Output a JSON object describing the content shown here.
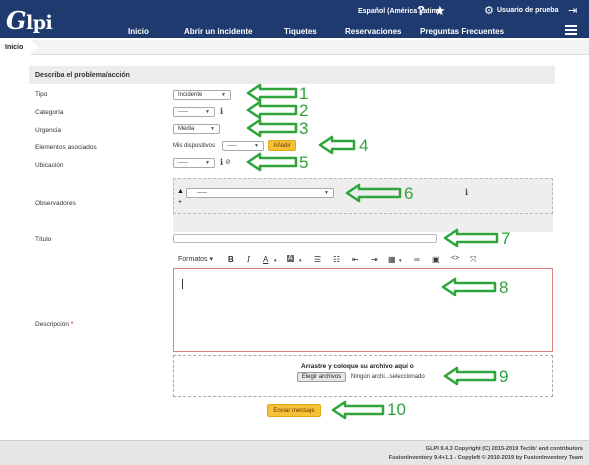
{
  "app": {
    "logo_text": "lpi",
    "logo_initial": "G"
  },
  "utility": {
    "language": "Español (América Latina)",
    "help_glyph": "?",
    "star_glyph": "★",
    "gear_glyph": "⚙",
    "user": "Usuario de prueba",
    "logout_glyph": "⇥"
  },
  "menu": {
    "items": [
      "Inicio",
      "Abrir un incidente",
      "Tiquetes",
      "Reservaciones",
      "Preguntas Frecuentes"
    ]
  },
  "breadcrumb": "Inicio",
  "form": {
    "header": "Describa el problema/acción",
    "tipo": {
      "label": "Tipo",
      "value": "Incidente"
    },
    "categoria": {
      "label": "Categoría",
      "value": "-----"
    },
    "urgencia": {
      "label": "Urgencia",
      "value": "Media"
    },
    "elementos": {
      "label": "Elementos asociados",
      "mis": "Mis dispositivos",
      "value": "-----",
      "add_button": "Añadir"
    },
    "ubicacion": {
      "label": "Ubicación",
      "value": "-----"
    },
    "observadores": {
      "label": "Observadores",
      "value": "-----"
    },
    "titulo": {
      "label": "Título",
      "value": ""
    },
    "descripcion": {
      "label": "Descripción",
      "required_mark": "*"
    },
    "toolbar": {
      "formats": "Formatos"
    },
    "dropzone": {
      "text": "Arrastre y coloque su archivo aquí o",
      "choose": "Elegir archivos",
      "none": "Ningún archi...seleccionado"
    },
    "submit": "Enviar mensaje"
  },
  "annotations": [
    "1",
    "2",
    "3",
    "4",
    "5",
    "6",
    "7",
    "8",
    "9",
    "10"
  ],
  "footer": {
    "line1": "GLPI 9.4.3 Copyright (C) 2015-2019 Teclib' and contributors",
    "line2": "FusionInventory 9.4+1.1 - Copyleft © 2010-2019 by FusionInventory Team"
  },
  "colors": {
    "header": "#1f3a6e",
    "accent_button": "#f6c037",
    "annotation": "#2ea43a",
    "required": "#cc0000"
  },
  "icons": [
    "help-icon",
    "star-icon",
    "gear-icon",
    "logout-icon",
    "hamburger-icon",
    "info-icon",
    "globe-icon",
    "person-icon",
    "plus-icon",
    "bold-icon",
    "italic-icon",
    "text-color-icon",
    "highlight-icon",
    "bullet-list-icon",
    "numbered-list-icon",
    "outdent-icon",
    "indent-icon",
    "table-icon",
    "link-icon",
    "image-icon",
    "code-icon",
    "fullscreen-icon"
  ]
}
